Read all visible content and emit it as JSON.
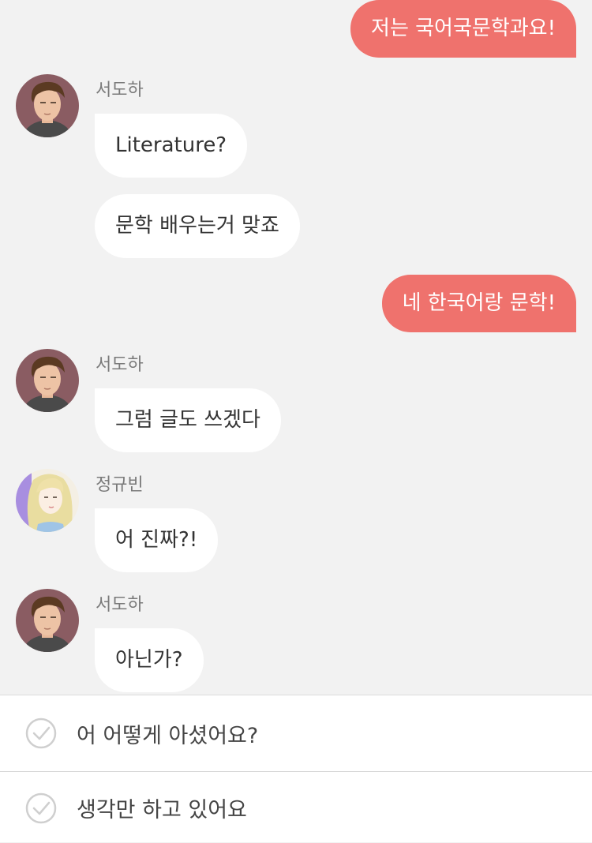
{
  "messages": [
    {
      "direction": "out",
      "text": "저는 국어국문학과요!"
    },
    {
      "direction": "in",
      "sender": "서도하",
      "avatar": "male-avatar",
      "texts": [
        "Literature?",
        "문학 배우는거 맞죠"
      ]
    },
    {
      "direction": "out",
      "text": "네 한국어랑 문학!"
    },
    {
      "direction": "in",
      "sender": "서도하",
      "avatar": "male-avatar",
      "texts": [
        "그럼 글도 쓰겠다"
      ]
    },
    {
      "direction": "in",
      "sender": "정규빈",
      "avatar": "female-avatar",
      "texts": [
        "어 진짜?!"
      ]
    },
    {
      "direction": "in",
      "sender": "서도하",
      "avatar": "male-avatar",
      "texts": [
        "아닌가?"
      ]
    }
  ],
  "reply_options": [
    {
      "label": "어 어떻게 아셨어요?",
      "icon": "check-circle-icon"
    },
    {
      "label": "생각만 하고 있어요",
      "icon": "check-circle-icon"
    }
  ],
  "colors": {
    "outgoing_bubble": "#ef726d",
    "incoming_bubble": "#ffffff",
    "background": "#f2f2f2"
  }
}
